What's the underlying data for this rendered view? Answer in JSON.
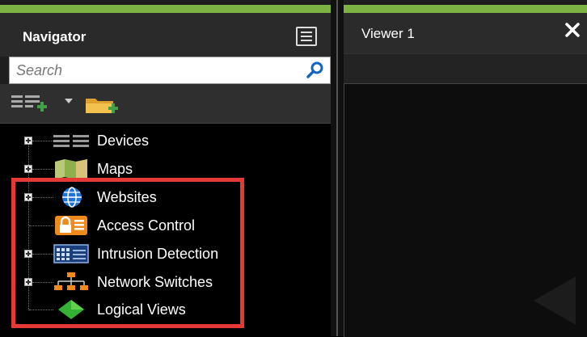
{
  "navigator": {
    "title": "Navigator",
    "search_placeholder": "Search",
    "tree": [
      {
        "label": "Devices",
        "icon": "devices-icon",
        "expandable": true
      },
      {
        "label": "Maps",
        "icon": "maps-icon",
        "expandable": true
      },
      {
        "label": "Websites",
        "icon": "globe-icon",
        "expandable": true
      },
      {
        "label": "Access Control",
        "icon": "lock-icon",
        "expandable": false
      },
      {
        "label": "Intrusion Detection",
        "icon": "keypad-icon",
        "expandable": true
      },
      {
        "label": "Network Switches",
        "icon": "network-switch-icon",
        "expandable": true
      },
      {
        "label": "Logical Views",
        "icon": "diamond-icon",
        "expandable": false
      }
    ]
  },
  "viewer": {
    "title": "Viewer 1"
  },
  "colors": {
    "accent_green": "#7cb342",
    "highlight_red": "#e53935",
    "lock_orange": "#f08a1c",
    "globe_blue": "#1e73d8",
    "diamond_green": "#34b233"
  }
}
